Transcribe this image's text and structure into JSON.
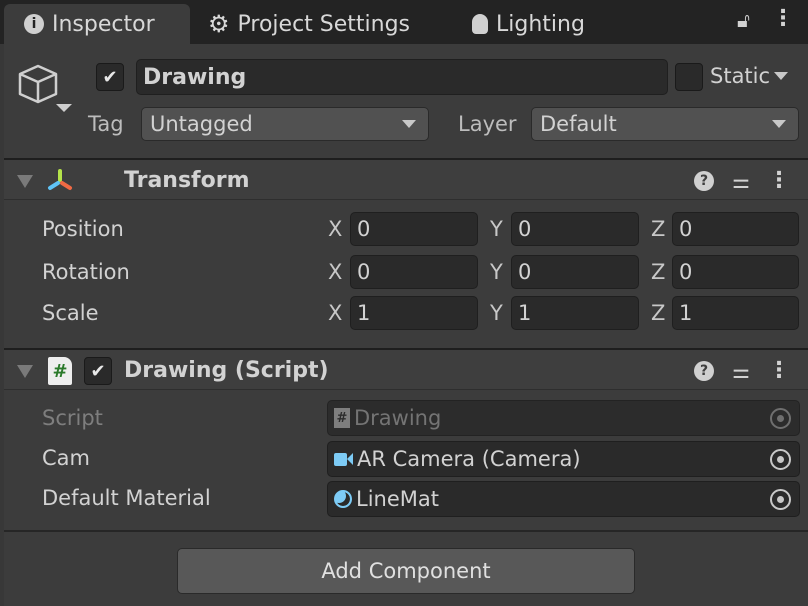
{
  "tabs": [
    {
      "label": "Inspector",
      "icon": "info-icon"
    },
    {
      "label": "Project Settings",
      "icon": "gear-icon"
    },
    {
      "label": "Lighting",
      "icon": "lightbulb-icon"
    }
  ],
  "object": {
    "name": "Drawing",
    "active": true,
    "static_label": "Static",
    "static": false,
    "tag_label": "Tag",
    "tag": "Untagged",
    "layer_label": "Layer",
    "layer": "Default"
  },
  "transform": {
    "title": "Transform",
    "rows": [
      {
        "label": "Position",
        "x": "0",
        "y": "0",
        "z": "0"
      },
      {
        "label": "Rotation",
        "x": "0",
        "y": "0",
        "z": "0"
      },
      {
        "label": "Scale",
        "x": "1",
        "y": "1",
        "z": "1"
      }
    ],
    "axes": {
      "x": "X",
      "y": "Y",
      "z": "Z"
    }
  },
  "script": {
    "title": "Drawing (Script)",
    "enabled": true,
    "fields": [
      {
        "label": "Script",
        "value": "Drawing"
      },
      {
        "label": "Cam",
        "value": "AR Camera (Camera)"
      },
      {
        "label": "Default Material",
        "value": "LineMat"
      }
    ]
  },
  "add_component": "Add Component",
  "colors": {
    "background": "#3c3c3c",
    "field": "#2a2a2a",
    "accent_blue": "#7dcbf5"
  }
}
